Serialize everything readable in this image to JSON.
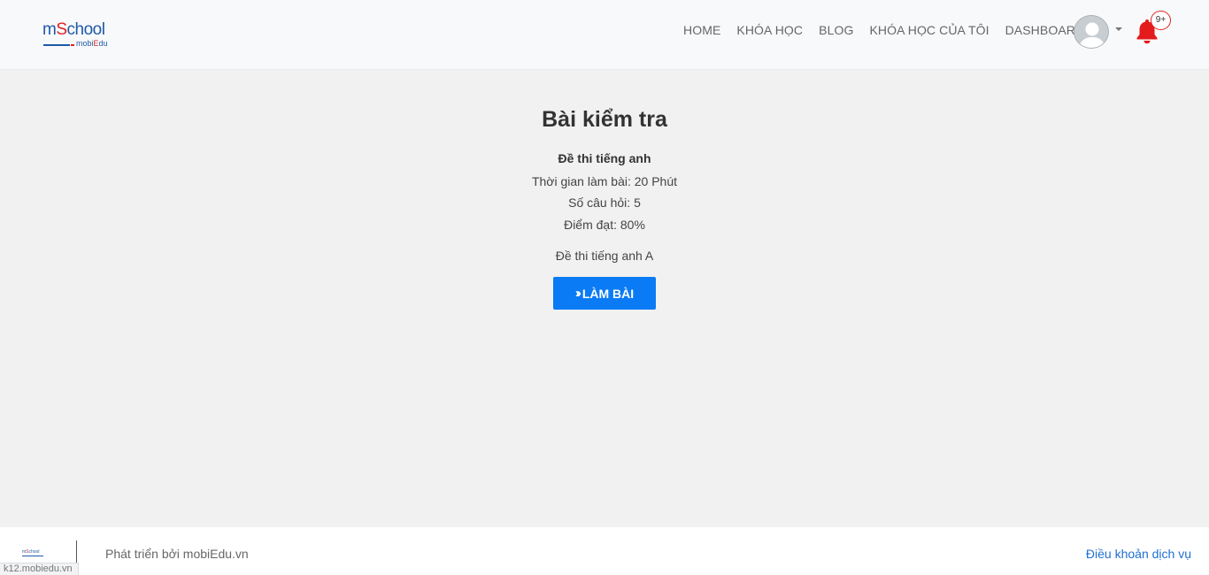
{
  "header": {
    "logo": {
      "main_prefix": "m",
      "main_s": "S",
      "main_rest": "chool",
      "sub_prefix": "mobi",
      "sub_e": "E",
      "sub_rest": "du"
    },
    "nav": [
      {
        "label": "HOME"
      },
      {
        "label": "KHÓA HỌC"
      },
      {
        "label": "BLOG"
      },
      {
        "label": "KHÓA HỌC CỦA TÔI"
      },
      {
        "label": "DASHBOARD"
      }
    ],
    "notification_count": "9+"
  },
  "main": {
    "title": "Bài kiểm tra",
    "exam_name": "Đề thi tiếng anh",
    "duration": "Thời gian làm bài: 20 Phút",
    "question_count": "Số câu hỏi: 5",
    "pass_score": "Điểm đạt: 80%",
    "description": "Đề thi tiếng anh A",
    "start_button": "LÀM BÀI"
  },
  "footer": {
    "logo": {
      "main_prefix": "m",
      "main_s": "S",
      "main_rest": "chool"
    },
    "developed_by": "Phát triển bởi mobiEdu.vn",
    "terms_link": "Điều khoản dịch vụ"
  },
  "status_url": "k12.mobiedu.vn",
  "colors": {
    "brand_blue": "#1e5aa8",
    "brand_red": "#e02424",
    "button_blue": "#0b7bf5",
    "link_blue": "#1f6fd1"
  }
}
